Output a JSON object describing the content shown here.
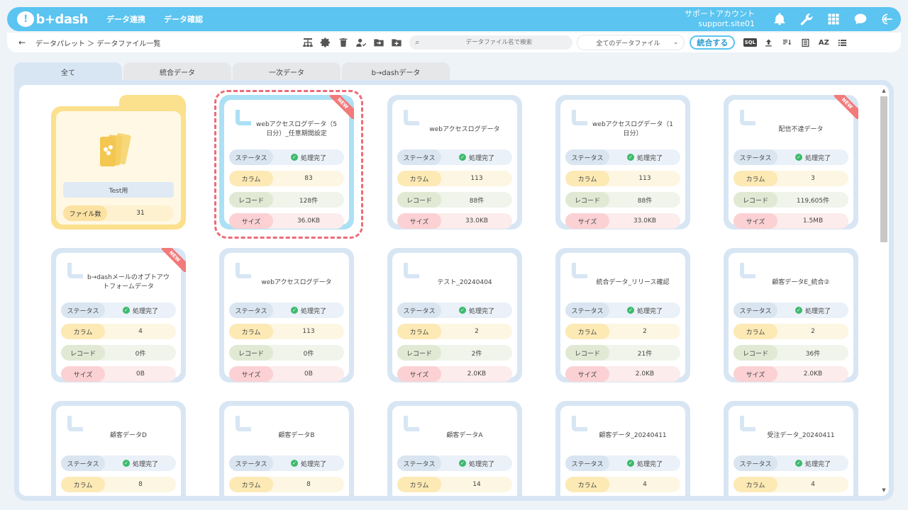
{
  "header": {
    "logo_text": "b+dash",
    "nav": [
      "データ連携",
      "データ確認"
    ],
    "account_name": "サポートアカウント",
    "account_site": "support.site01"
  },
  "toolbar": {
    "back_label": "←",
    "breadcrumb": "データパレット ＞ データファイル一覧",
    "search_placeholder": "データファイル名で検索",
    "filter_selected": "全てのデータファイル",
    "merge_label": "統合する",
    "sql_label": "SQL",
    "az_label": "AZ"
  },
  "tabs": [
    "全て",
    "統合データ",
    "一次データ",
    "b→dashデータ"
  ],
  "labels": {
    "status": "ステータス",
    "column": "カラム",
    "record": "レコード",
    "size": "サイズ",
    "new": "NEW",
    "file_count": "ファイル数"
  },
  "folder": {
    "name": "Test用",
    "file_count": "31"
  },
  "cards": [
    {
      "title": "webアクセスログデータ（5日分）_任意期間設定",
      "status": "処理完了",
      "column": "83",
      "record": "128件",
      "size": "36.0KB",
      "new": true,
      "selected": true
    },
    {
      "title": "webアクセスログデータ",
      "status": "処理完了",
      "column": "113",
      "record": "88件",
      "size": "33.0KB",
      "new": false
    },
    {
      "title": "webアクセスログデータ（1日分）",
      "status": "処理完了",
      "column": "113",
      "record": "88件",
      "size": "33.0KB",
      "new": false
    },
    {
      "title": "配信不達データ",
      "status": "処理完了",
      "column": "3",
      "record": "119,605件",
      "size": "1.5MB",
      "new": true
    },
    {
      "title": "b→dashメールのオプトアウトフォームデータ",
      "status": "処理完了",
      "column": "4",
      "record": "0件",
      "size": "0B",
      "new": true
    },
    {
      "title": "webアクセスログデータ",
      "status": "処理完了",
      "column": "113",
      "record": "0件",
      "size": "0B",
      "new": false
    },
    {
      "title": "テスト_20240404",
      "status": "処理完了",
      "column": "2",
      "record": "2件",
      "size": "2.0KB",
      "new": false
    },
    {
      "title": "統合データ_リリース確認",
      "status": "処理完了",
      "column": "2",
      "record": "21件",
      "size": "2.0KB",
      "new": false
    },
    {
      "title": "顧客データE_統合②",
      "status": "処理完了",
      "column": "2",
      "record": "36件",
      "size": "2.0KB",
      "new": false
    },
    {
      "title": "顧客データD",
      "status": "処理完了",
      "column": "8",
      "record": "",
      "size": "",
      "new": false
    },
    {
      "title": "顧客データB",
      "status": "処理完了",
      "column": "8",
      "record": "",
      "size": "",
      "new": false
    },
    {
      "title": "顧客データA",
      "status": "処理完了",
      "column": "14",
      "record": "",
      "size": "",
      "new": false
    },
    {
      "title": "顧客データ_20240411",
      "status": "処理完了",
      "column": "4",
      "record": "",
      "size": "",
      "new": false
    },
    {
      "title": "受注データ_20240411",
      "status": "処理完了",
      "column": "4",
      "record": "",
      "size": "",
      "new": false
    }
  ]
}
